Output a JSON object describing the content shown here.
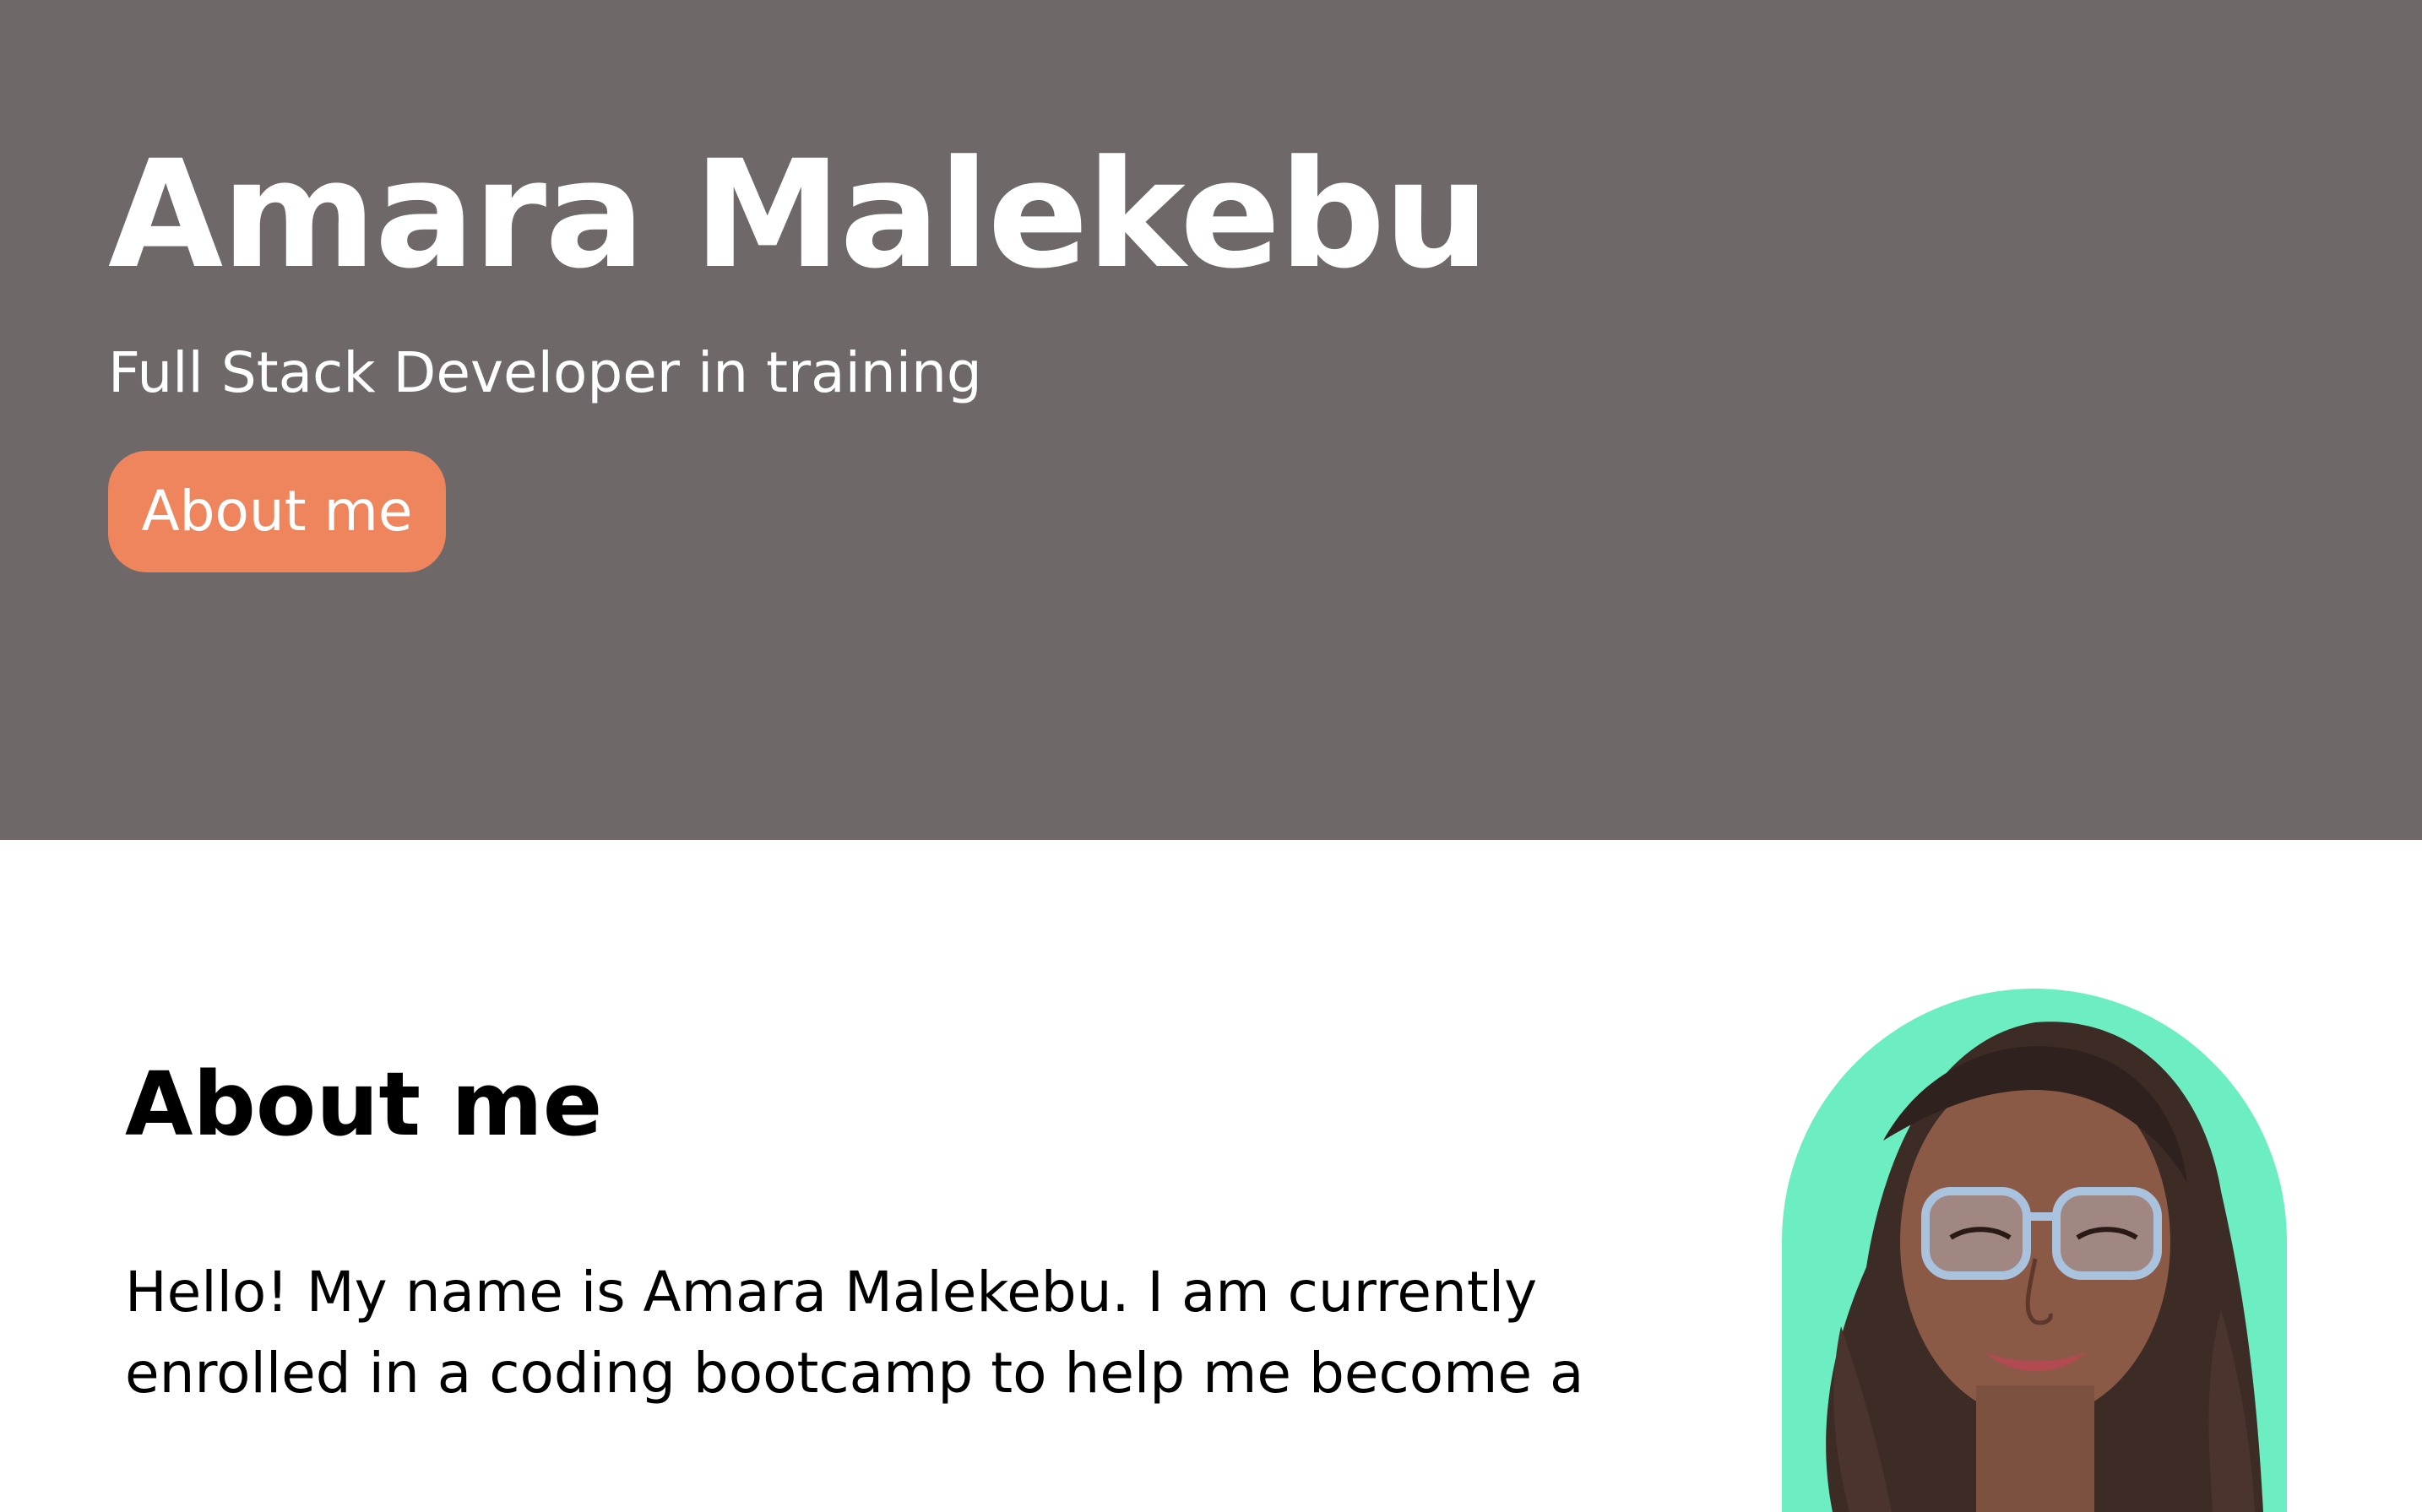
{
  "hero": {
    "title": "Amara Malekebu",
    "subtitle": "Full Stack Developer in training",
    "button_label": "About me",
    "background_color": "#6e6968",
    "button_color": "#ee855d"
  },
  "about": {
    "heading": "About me",
    "paragraph": "Hello! My name is Amara Malekebu. I am currently enrolled in a coding bootcamp to help me become a",
    "portrait_background_color": "#6cedc2"
  }
}
